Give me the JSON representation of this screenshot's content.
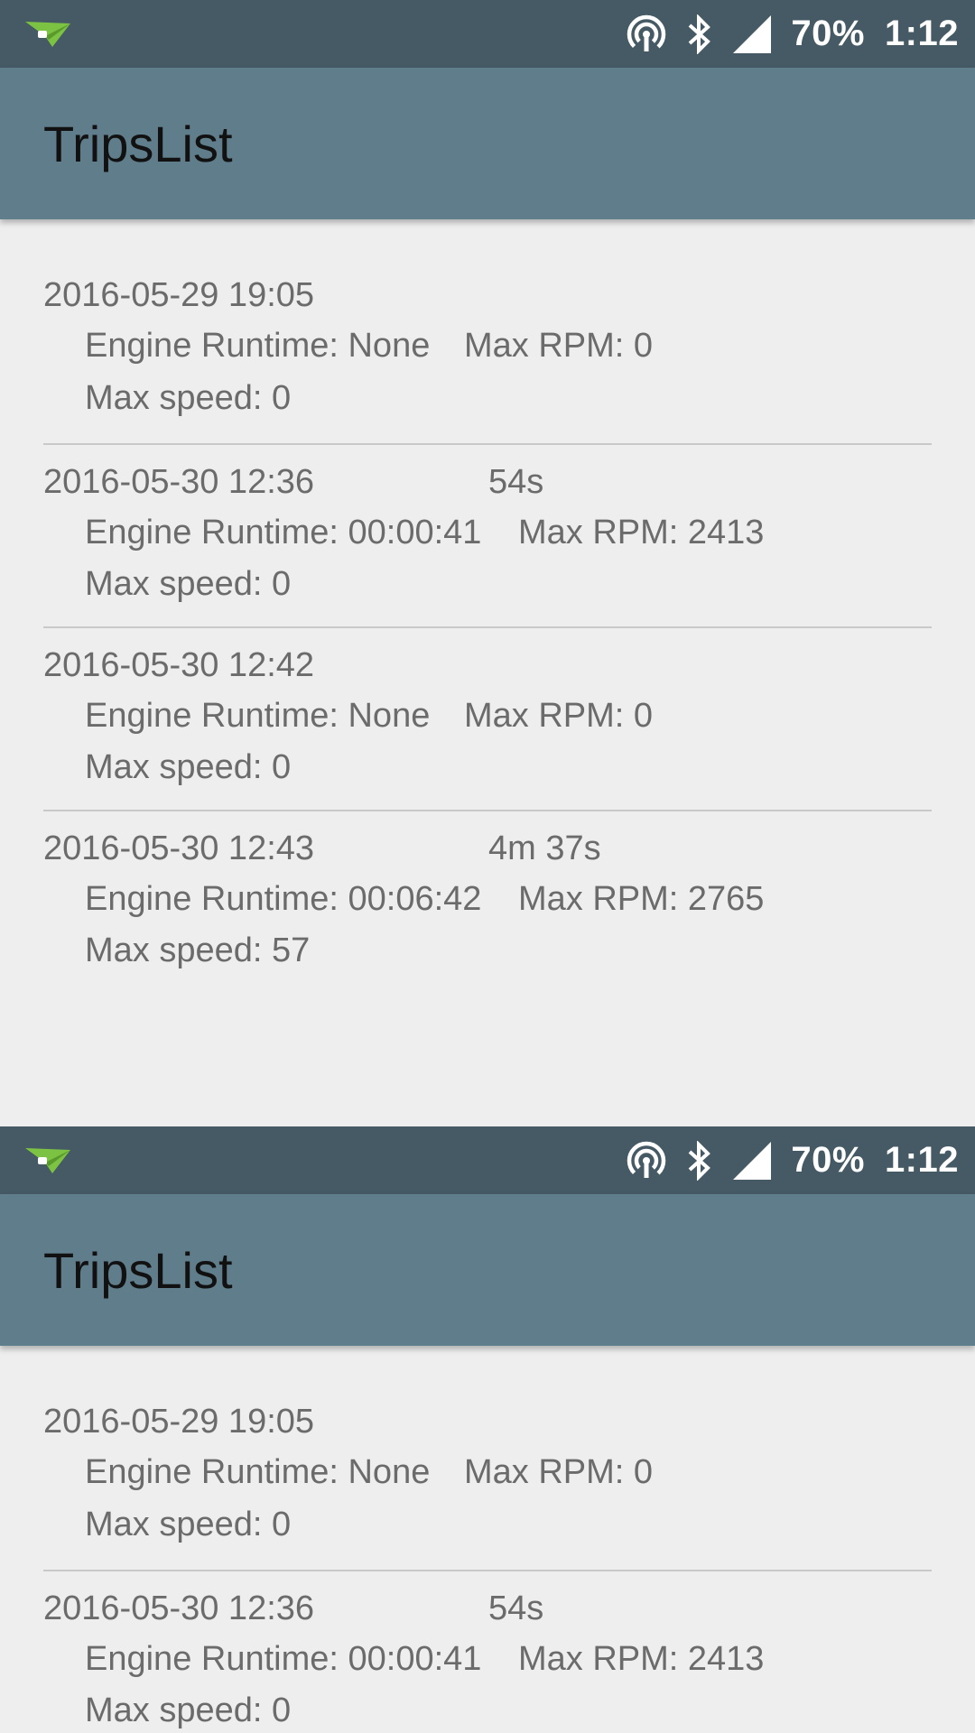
{
  "status_bar": {
    "battery": "70%",
    "time": "1:12",
    "icons": [
      "app-paper-plane-icon",
      "hotspot-icon",
      "bluetooth-icon",
      "cell-signal-icon"
    ]
  },
  "app_bar": {
    "title": "TripsList"
  },
  "trips": [
    {
      "datetime": "2016-05-29 19:05",
      "duration": "",
      "engine_runtime": "Engine Runtime: None",
      "max_rpm": "Max RPM: 0",
      "max_speed": "Max speed: 0"
    },
    {
      "datetime": "2016-05-30 12:36",
      "duration": "54s",
      "engine_runtime": "Engine Runtime: 00:00:41",
      "max_rpm": "Max RPM: 2413",
      "max_speed": "Max speed: 0"
    },
    {
      "datetime": "2016-05-30 12:42",
      "duration": "",
      "engine_runtime": "Engine Runtime: None",
      "max_rpm": "Max RPM: 0",
      "max_speed": "Max speed: 0"
    },
    {
      "datetime": "2016-05-30 12:43",
      "duration": "4m 37s",
      "engine_runtime": "Engine Runtime: 00:06:42",
      "max_rpm": "Max RPM: 2765",
      "max_speed": "Max speed: 57"
    }
  ],
  "colors": {
    "status_bar": "#455a64",
    "app_bar": "#607d8b",
    "background": "#eeeeee",
    "list_text": "#6b6b6b",
    "divider": "#c9c9c9",
    "app_icon": "#7cc243"
  }
}
